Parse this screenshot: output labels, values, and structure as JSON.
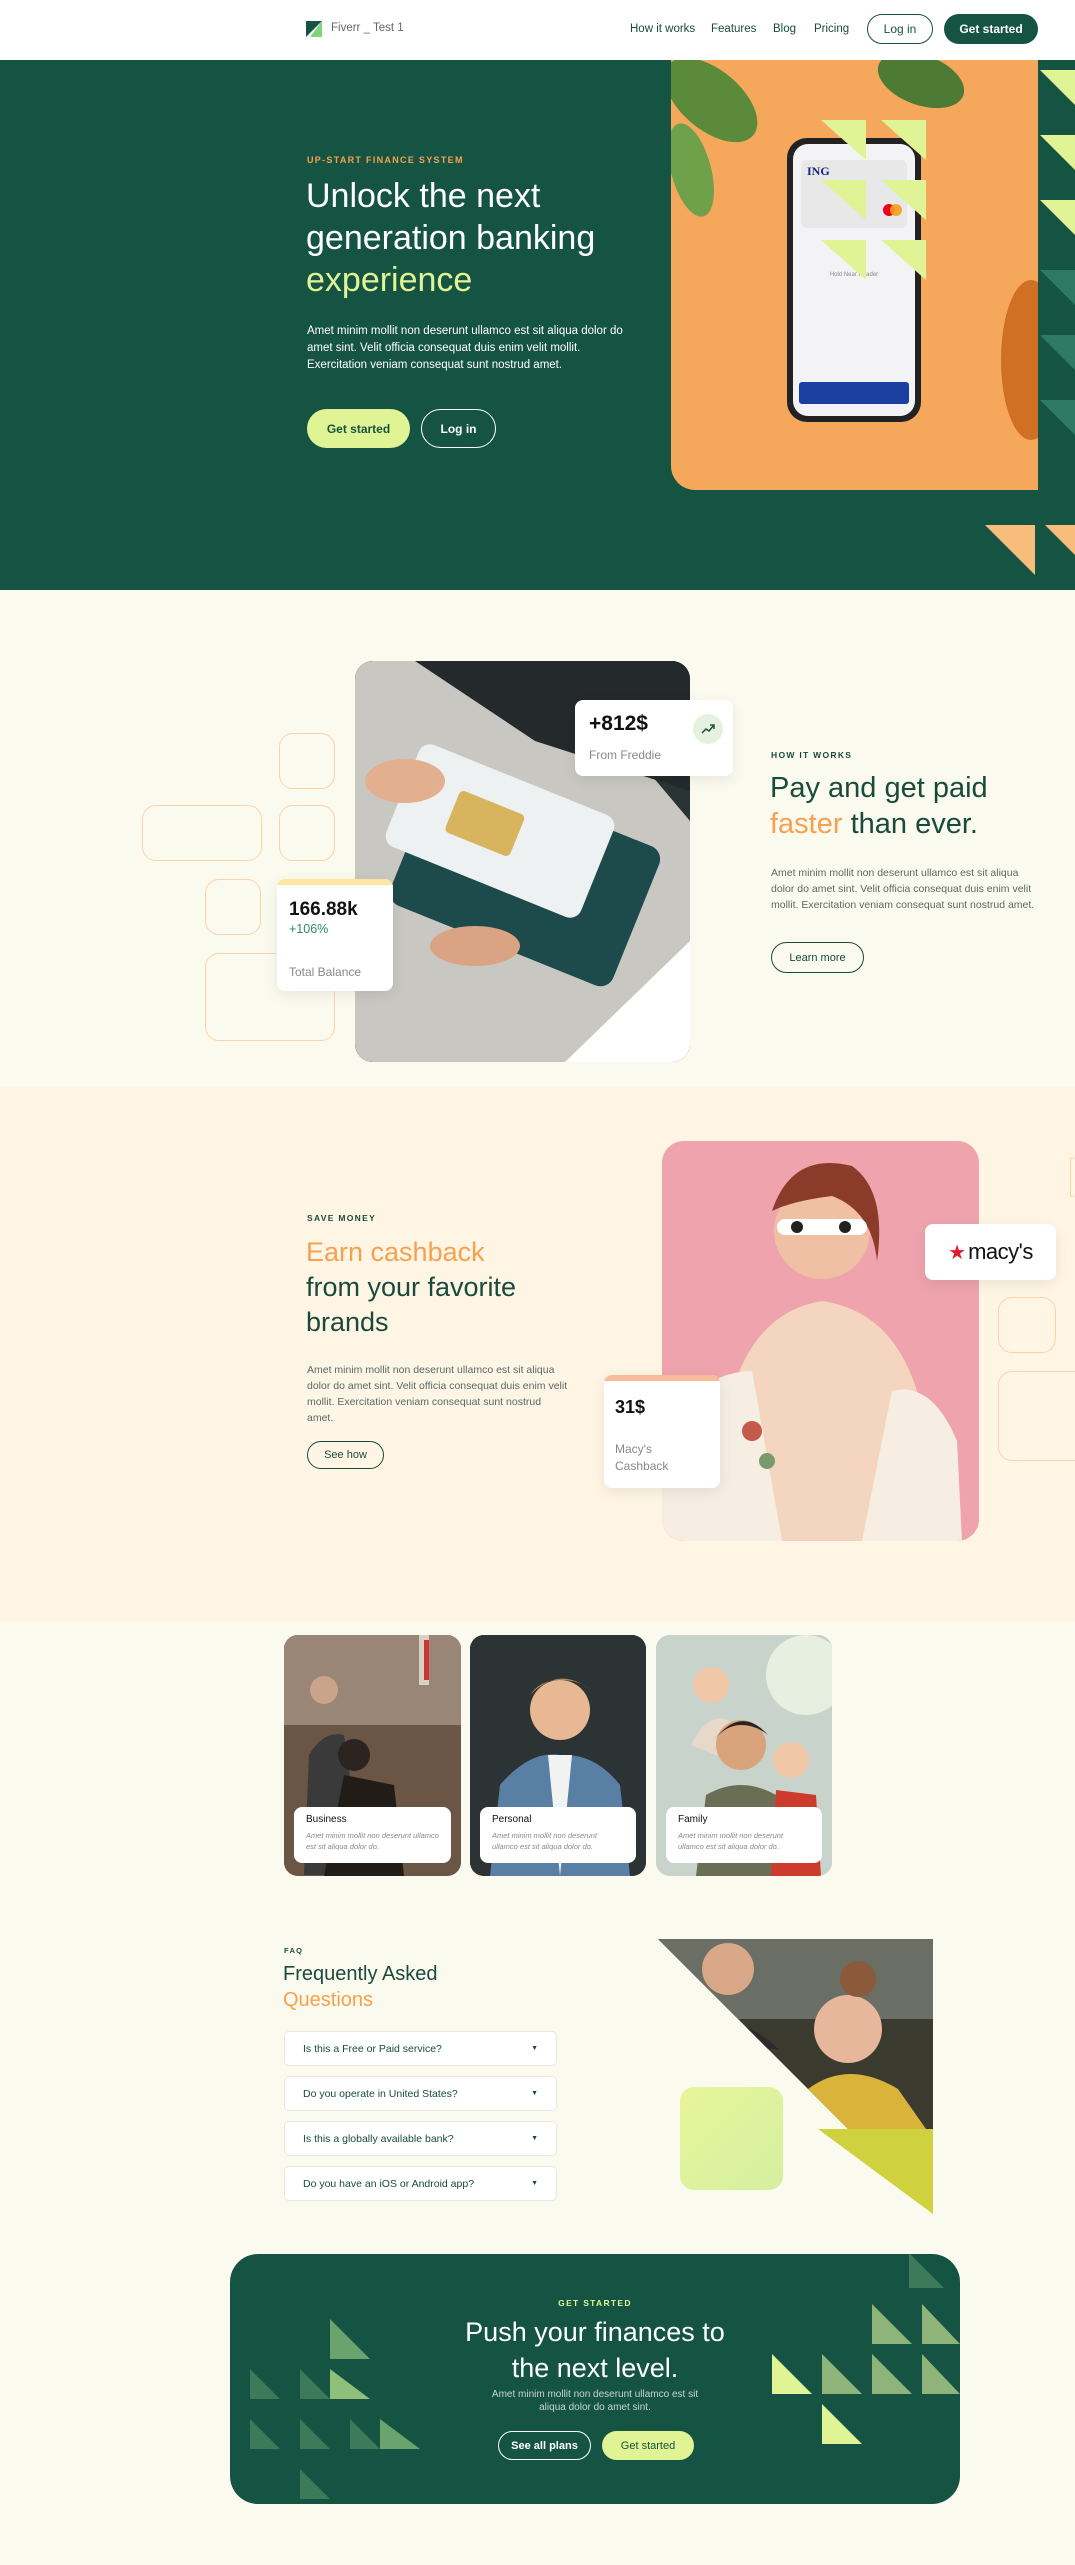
{
  "brand": {
    "name": "Fiverr _ Test 1",
    "accent": "#155443",
    "lime": "#e0f495",
    "orange": "#f7a14f"
  },
  "nav": {
    "links": [
      "How it works",
      "Features",
      "Blog",
      "Pricing"
    ],
    "login": "Log in",
    "cta": "Get started"
  },
  "hero": {
    "eyebrow": "UP-START FINANCE SYSTEM",
    "title_line1": "Unlock the next",
    "title_line2": "generation banking",
    "title_line3": "experience",
    "body": "Amet minim mollit non deserunt ullamco est sit aliqua dolor do amet sint. Velit officia consequat duis enim velit mollit. Exercitation veniam consequat sunt nostrud amet.",
    "cta": "Get started",
    "login": "Log in",
    "phone": {
      "bank": "ING",
      "reader": "Hold Near Reader"
    }
  },
  "how": {
    "eyebrow": "HOW IT WORKS",
    "title_a": "Pay and get paid",
    "title_b": "faster",
    "title_c": "than ever.",
    "body": "Amet minim mollit non deserunt ullamco est sit aliqua dolor do amet sint. Velit officia consequat duis enim velit mollit. Exercitation veniam consequat sunt nostrud amet.",
    "button": "Learn more",
    "stat_card": {
      "value": "+812$",
      "label": "From Freddie"
    },
    "balance_card": {
      "value": "166.88k",
      "change": "+106%",
      "label": "Total Balance"
    }
  },
  "cashback": {
    "eyebrow": "SAVE MONEY",
    "title_a": "Earn cashback",
    "title_b": "from your favorite",
    "title_c": "brands",
    "body": "Amet minim mollit non deserunt ullamco est sit aliqua dolor do amet sint. Velit officia consequat duis enim velit mollit. Exercitation veniam consequat sunt nostrud amet.",
    "button": "See how",
    "brand": "macy's",
    "card": {
      "value": "31$",
      "label_line1": "Macy's",
      "label_line2": "Cashback"
    }
  },
  "segments": [
    {
      "title": "Business",
      "desc": "Amet minim mollit non deserunt ullamco est sit aliqua dolor do."
    },
    {
      "title": "Personal",
      "desc": "Amet minim mollit non deserunt ullamco est sit aliqua dolor do."
    },
    {
      "title": "Family",
      "desc": "Amet minim mollit non deserunt ullamco est sit aliqua dolor do."
    }
  ],
  "faq": {
    "eyebrow": "FAQ",
    "title_a": "Frequently Asked",
    "title_b": "Questions",
    "items": [
      "Is this a Free or Paid service?",
      "Do you operate in United States?",
      "Is this a globally available bank?",
      "Do you have an iOS or Android app?"
    ]
  },
  "footer_cta": {
    "eyebrow": "GET STARTED",
    "title_line1": "Push your finances to",
    "title_line2": "the next level.",
    "body_line1": "Amet minim mollit non deserunt ullamco est sit",
    "body_line2": "aliqua dolor do amet sint.",
    "secondary": "See all plans",
    "primary": "Get started"
  }
}
